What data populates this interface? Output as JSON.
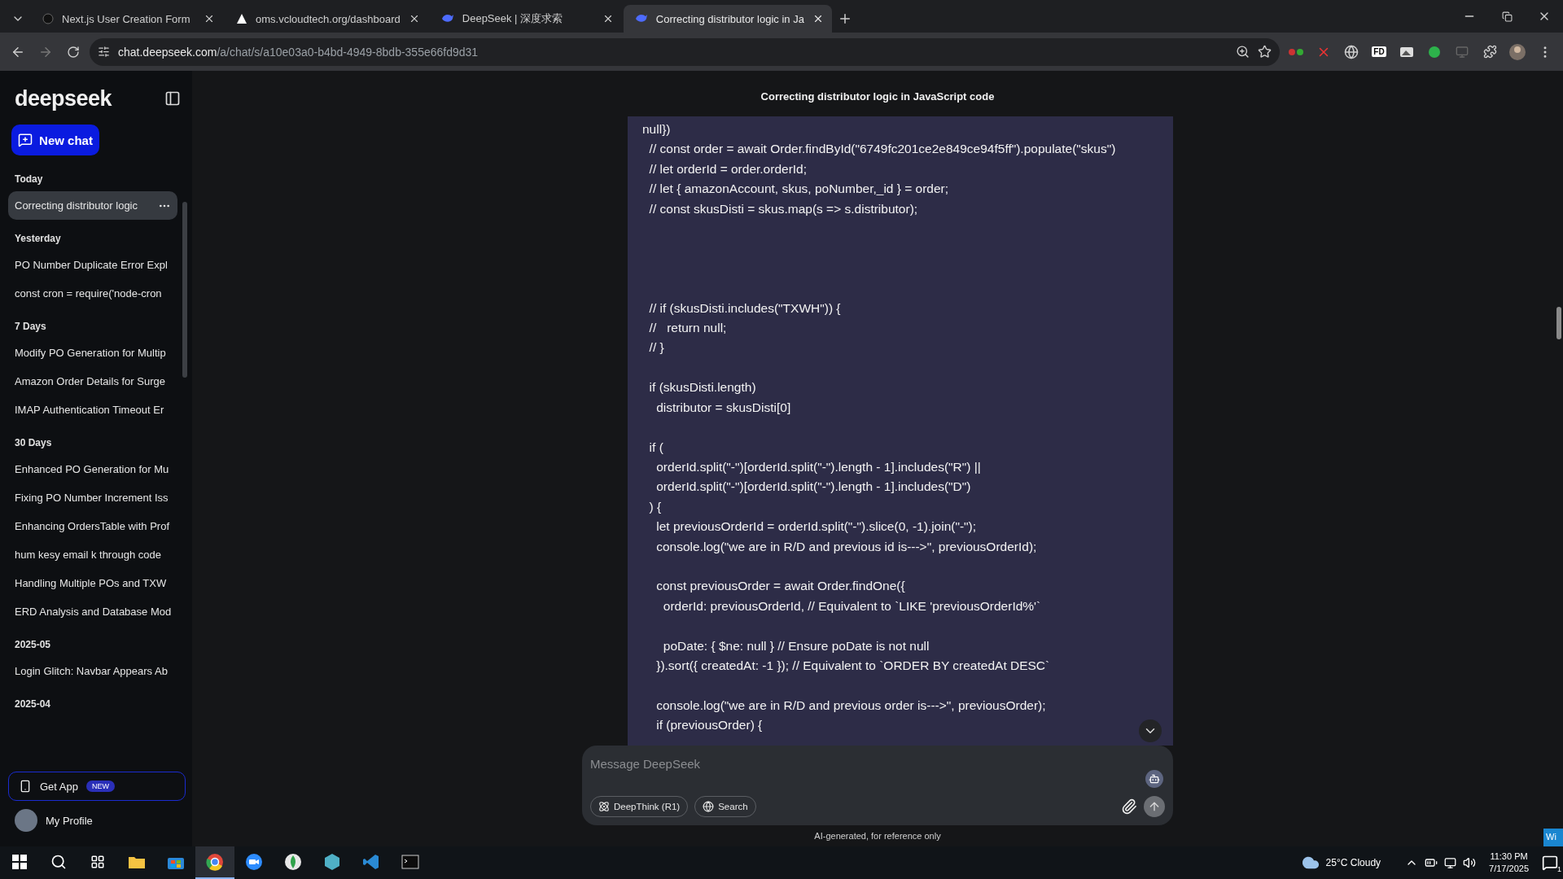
{
  "browser": {
    "tabs": [
      {
        "title": "Next.js User Creation Form",
        "kind": "dark",
        "selected": false
      },
      {
        "title": "oms.vcloudtech.org/dashboard",
        "kind": "triangle",
        "selected": false
      },
      {
        "title": "DeepSeek | 深度求索",
        "kind": "whale",
        "selected": false
      },
      {
        "title": "Correcting distributor logic in Ja",
        "kind": "whale",
        "selected": true
      }
    ],
    "url_host": "chat.deepseek.com",
    "url_path": "/a/chat/s/a10e03a0-b4bd-4949-8bdb-355e66fd9d31",
    "extension_badge": "FD"
  },
  "sidebar": {
    "logo": "deepseek",
    "new_chat": "New chat",
    "groups": [
      {
        "label": "Today",
        "items": [
          {
            "title": "Correcting distributor logic",
            "selected": true
          }
        ]
      },
      {
        "label": "Yesterday",
        "items": [
          {
            "title": "PO Number Duplicate Error Expl",
            "selected": false
          },
          {
            "title": "const cron = require('node-cron",
            "selected": false
          }
        ]
      },
      {
        "label": "7 Days",
        "items": [
          {
            "title": "Modify PO Generation for Multip",
            "selected": false
          },
          {
            "title": "Amazon Order Details for Surge",
            "selected": false
          },
          {
            "title": "IMAP Authentication Timeout Er",
            "selected": false
          }
        ]
      },
      {
        "label": "30 Days",
        "items": [
          {
            "title": "Enhanced PO Generation for Mu",
            "selected": false
          },
          {
            "title": "Fixing PO Number Increment Iss",
            "selected": false
          },
          {
            "title": "Enhancing OrdersTable with Prof",
            "selected": false
          },
          {
            "title": "hum kesy email k through code",
            "selected": false
          },
          {
            "title": "Handling Multiple POs and TXW",
            "selected": false
          },
          {
            "title": "ERD Analysis and Database Mod",
            "selected": false
          }
        ]
      },
      {
        "label": "2025-05",
        "items": [
          {
            "title": "Login Glitch: Navbar Appears Ab",
            "selected": false
          }
        ]
      },
      {
        "label": "2025-04"
      }
    ],
    "get_app": "Get App",
    "get_app_badge": "NEW",
    "profile": "My Profile"
  },
  "chat": {
    "title": "Correcting distributor logic in JavaScript code",
    "code": "null})\n  // const order = await Order.findById(\"6749fc201ce2e849ce94f5ff\").populate(\"skus\")\n  // let orderId = order.orderId;\n  // let { amazonAccount, skus, poNumber,_id } = order;\n  // const skusDisti = skus.map(s => s.distributor);\n\n\n\n\n  // if (skusDisti.includes(\"TXWH\")) {\n  //   return null;\n  // }\n\n  if (skusDisti.length)\n    distributor = skusDisti[0]\n\n  if (\n    orderId.split(\"-\")[orderId.split(\"-\").length - 1].includes(\"R\") ||\n    orderId.split(\"-\")[orderId.split(\"-\").length - 1].includes(\"D\")\n  ) {\n    let previousOrderId = orderId.split(\"-\").slice(0, -1).join(\"-\");\n    console.log(\"we are in R/D and previous id is--->\", previousOrderId);\n\n    const previousOrder = await Order.findOne({\n      orderId: previousOrderId, // Equivalent to `LIKE 'previousOrderId%'`\n\n      poDate: { $ne: null } // Ensure poDate is not null\n    }).sort({ createdAt: -1 }); // Equivalent to `ORDER BY createdAt DESC`\n\n    console.log(\"we are in R/D and previous order is--->\", previousOrder);\n    if (previousOrder) {",
    "input": {
      "placeholder": "Message DeepSeek"
    },
    "chips": [
      {
        "label": "DeepThink (R1)",
        "kind": "think"
      },
      {
        "label": "Search",
        "kind": "web"
      }
    ],
    "footer": "AI-generated, for reference only"
  },
  "taskbar": {
    "apps": [
      {
        "kind": "explorer",
        "selected": false
      },
      {
        "kind": "store",
        "selected": false
      },
      {
        "kind": "chrome",
        "selected": true
      },
      {
        "kind": "zoom",
        "selected": false
      },
      {
        "kind": "mongo",
        "selected": false
      },
      {
        "kind": "hex",
        "selected": false
      },
      {
        "kind": "vscode",
        "selected": false
      },
      {
        "kind": "terminal",
        "selected": false
      }
    ],
    "weather": "25°C Cloudy",
    "time": "11:30 PM",
    "date": "7/17/2025",
    "notifications": "1"
  },
  "corner_popup": "Wi"
}
